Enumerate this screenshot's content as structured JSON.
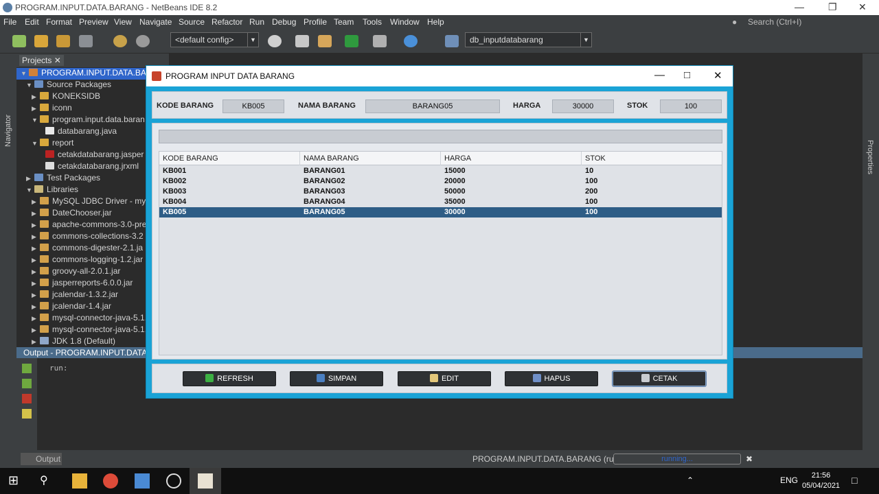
{
  "titlebar": {
    "title": "PROGRAM.INPUT.DATA.BARANG - NetBeans IDE 8.2"
  },
  "menubar": {
    "items": [
      "File",
      "Edit",
      "Format",
      "View",
      "Navigate",
      "Source",
      "Refactor",
      "Run",
      "Debug",
      "Profile",
      "Team",
      "Tools",
      "Window",
      "Help"
    ],
    "search_placeholder": "Search (Ctrl+I)"
  },
  "toolbar": {
    "config": "<default config>",
    "connection": "db_inputdatabarang"
  },
  "sidestrips": {
    "left": "Navigator",
    "right": "Properties"
  },
  "projects": {
    "tab_label": "Projects",
    "tree": [
      "PROGRAM.INPUT.DATA.BAR",
      "Source Packages",
      "KONEKSIDB",
      "iconn",
      "program.input.data.baran",
      "databarang.java",
      "report",
      "cetakdatabarang.jasper",
      "cetakdatabarang.jrxml",
      "Test Packages",
      "Libraries",
      "MySQL JDBC Driver - mys",
      "DateChooser.jar",
      "apache-commons-3.0-pre",
      "commons-collections-3.2",
      "commons-digester-2.1.ja",
      "commons-logging-1.2.jar",
      "groovy-all-2.0.1.jar",
      "jasperreports-6.0.0.jar",
      "jcalendar-1.3.2.jar",
      "jcalendar-1.4.jar",
      "mysql-connector-java-5.1.",
      "mysql-connector-java-5.1.",
      "JDK 1.8 (Default)"
    ]
  },
  "output": {
    "title": "Output - PROGRAM.INPUT.DATA.B",
    "console": "run:"
  },
  "statusbar": {
    "output_tab": "Output",
    "process": "PROGRAM.INPUT.DATA.BARANG (run)",
    "progress_label": "running..."
  },
  "app": {
    "title": "PROGRAM INPUT DATA BARANG",
    "form": {
      "kode_label": "KODE BARANG",
      "kode_value": "KB005",
      "nama_label": "NAMA BARANG",
      "nama_value": "BARANG05",
      "harga_label": "HARGA",
      "harga_value": "30000",
      "stok_label": "STOK",
      "stok_value": "100"
    },
    "table": {
      "headers": [
        "KODE BARANG",
        "NAMA BARANG",
        "HARGA",
        "STOK"
      ],
      "rows": [
        [
          "KB001",
          "BARANG01",
          "15000",
          "10"
        ],
        [
          "KB002",
          "BARANG02",
          "20000",
          "100"
        ],
        [
          "KB003",
          "BARANG03",
          "50000",
          "200"
        ],
        [
          "KB004",
          "BARANG04",
          "35000",
          "100"
        ],
        [
          "KB005",
          "BARANG05",
          "30000",
          "100"
        ]
      ]
    },
    "buttons": {
      "refresh": "REFRESH",
      "simpan": "SIMPAN",
      "edit": "EDIT",
      "hapus": "HAPUS",
      "cetak": "CETAK"
    }
  },
  "taskbar": {
    "lang": "ENG",
    "time": "21:56",
    "date": "05/04/2021"
  }
}
